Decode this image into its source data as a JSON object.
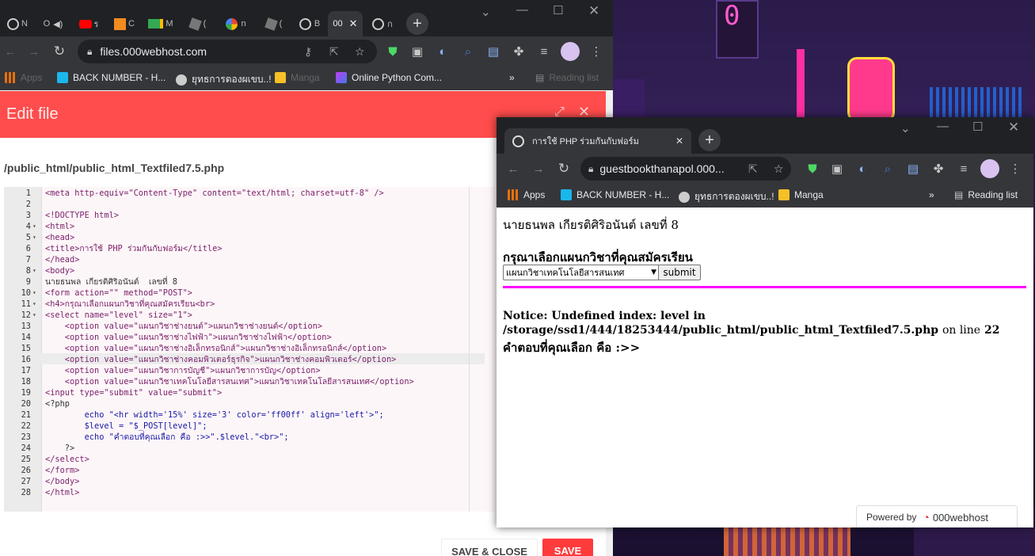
{
  "back_window": {
    "tabs": [
      {
        "label": "N",
        "icon": "globe-icon"
      },
      {
        "label": "O",
        "icon": "speaker-icon"
      },
      {
        "label": "ร",
        "icon": "youtube-icon"
      },
      {
        "label": "C",
        "icon": "contacts-icon"
      },
      {
        "label": "M",
        "icon": "meet-icon"
      },
      {
        "label": "(",
        "icon": "puzzle-icon"
      },
      {
        "label": "n",
        "icon": "google-icon"
      },
      {
        "label": "(",
        "icon": "puzzle-icon"
      },
      {
        "label": "B",
        "icon": "globe-icon"
      },
      {
        "label": "00",
        "icon": "webhost-icon"
      },
      {
        "label": "ก",
        "icon": "globe-icon"
      }
    ],
    "close_glyph": "✕",
    "new_tab_glyph": "+",
    "url": "files.000webhost.com",
    "bookmarks": [
      {
        "label": "Apps"
      },
      {
        "label": "BACK NUMBER - H..."
      },
      {
        "label": "ยุทธการตองผเขบ..!"
      },
      {
        "label": "Manga"
      },
      {
        "label": "Online Python Com..."
      }
    ],
    "bookmarks_more": "»",
    "reading_list": "Reading list",
    "edit_file_title": "Edit file",
    "file_path": "/public_html/public_html_Textfiled7.5.php",
    "code_lines": [
      "<meta http-equiv=\"Content-Type\" content=\"text/html; charset=utf-8\" />",
      "",
      "<!DOCTYPE html>",
      "<html>",
      "<head>",
      "<title>การใช้ PHP ร่วมกันกับฟอร์ม</title>",
      "</head>",
      "<body>",
      "นายธนพล เกียรติศิริอนันต์  เลขที่ 8",
      "<form action=\"\" method=\"POST\">",
      "<h4>กรุณาเลือกแผนกวิชาที่คุณสมัครเรียน<br>",
      "<select name=\"level\" size=\"1\">",
      "    <option value=\"แผนกวิชาช่างยนต์\">แผนกวิชาช่างยนต์</option>",
      "    <option value=\"แผนกวิชาช่างไฟฟ้า\">แผนกวิชาช่างไฟฟ้า</option>",
      "    <option value=\"แผนกวิชาช่างอิเล็กทรอนิกส์\">แผนกวิชาช่างอิเล็กทรอนิกส์</option>",
      "    <option value=\"แผนกวิชาช่างคอมพิวเตอร์ธุรกิจ\">แผนกวิชาช่างคอมพิวเตอร์</option>",
      "    <option value=\"แผนกวิชาการบัญชี\">แผนกวิชาการบัญ</option>",
      "    <option value=\"แผนกวิชาเทคโนโลยีสารสนเทศ\">แผนกวิชาเทคโนโลยีสารสนเทศ</option>",
      "<input type=\"submit\" value=\"submit\">",
      "<?php",
      "        echo \"<hr width='15%' size='3' color='ff00ff' align='left'>\";",
      "        $level = \"$_POST[level]\";",
      "        echo \"คำตอบที่คุณเลือก คือ :>>\".$level.\"<br>\";",
      "    ?>",
      "</select>",
      "</form>",
      "</body>",
      "</html>"
    ],
    "line_numbers": [
      "1",
      "2",
      "3",
      "4",
      "5",
      "6",
      "7",
      "8",
      "9",
      "10",
      "11",
      "12",
      "13",
      "14",
      "15",
      "16",
      "17",
      "18",
      "19",
      "20",
      "21",
      "22",
      "23",
      "24",
      "25",
      "26",
      "27",
      "28"
    ],
    "fold_marker": "▾",
    "save_close_label": "SAVE & CLOSE",
    "save_label": "SAVE"
  },
  "front_window": {
    "tab_title": "การใช้ PHP ร่วมกันกับฟอร์ม",
    "close_glyph": "✕",
    "new_tab_glyph": "+",
    "url": "guestbookthanapol.000...",
    "bookmarks": [
      {
        "label": "Apps"
      },
      {
        "label": "BACK NUMBER - H..."
      },
      {
        "label": "ยุทธการตองผเขบ..!"
      },
      {
        "label": "Manga"
      }
    ],
    "bookmarks_more": "»",
    "reading_list": "Reading list",
    "page": {
      "name_line": "นายธนพล เกียรติศิริอนันต์ เลขที่ 8",
      "heading": "กรุณาเลือกแผนกวิชาที่คุณสมัครเรียน",
      "select_value": "แผนกวิชาเทคโนโลยีสารสนเทศ",
      "submit_label": "submit",
      "hr_color": "#ff00ff",
      "notice_label": "Notice",
      "notice_text": ": Undefined index: level in",
      "notice_path": "/storage/ssd1/444/18253444/public_html/public_html_Textfiled7.5.php",
      "notice_on_line": "on line",
      "notice_line_no": "22",
      "answer_text": "คำตอบที่คุณเลือก คือ :>>"
    },
    "powered_by": "Powered by",
    "webhost_brand": "000webhost"
  },
  "colors": {
    "edit_header": "#ff4c4c",
    "save_button": "#ff3b3b",
    "browser_dark": "#35363a"
  }
}
